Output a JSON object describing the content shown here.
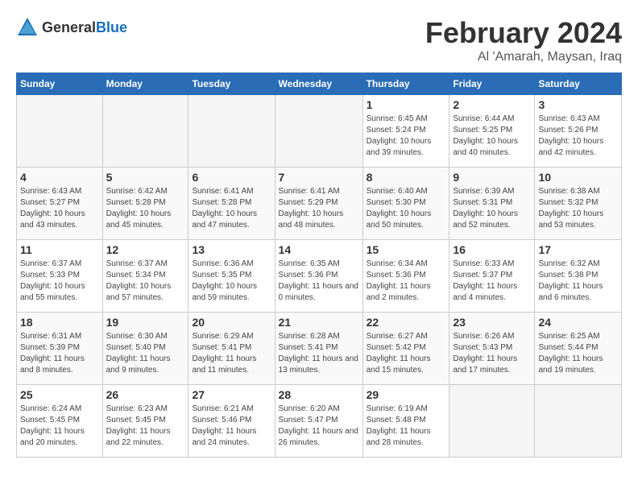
{
  "header": {
    "logo_general": "General",
    "logo_blue": "Blue",
    "month": "February 2024",
    "location": "Al 'Amarah, Maysan, Iraq"
  },
  "weekdays": [
    "Sunday",
    "Monday",
    "Tuesday",
    "Wednesday",
    "Thursday",
    "Friday",
    "Saturday"
  ],
  "weeks": [
    [
      {
        "day": "",
        "empty": true
      },
      {
        "day": "",
        "empty": true
      },
      {
        "day": "",
        "empty": true
      },
      {
        "day": "",
        "empty": true
      },
      {
        "day": "1",
        "sunrise": "6:45 AM",
        "sunset": "5:24 PM",
        "daylight": "10 hours and 39 minutes."
      },
      {
        "day": "2",
        "sunrise": "6:44 AM",
        "sunset": "5:25 PM",
        "daylight": "10 hours and 40 minutes."
      },
      {
        "day": "3",
        "sunrise": "6:43 AM",
        "sunset": "5:26 PM",
        "daylight": "10 hours and 42 minutes."
      }
    ],
    [
      {
        "day": "4",
        "sunrise": "6:43 AM",
        "sunset": "5:27 PM",
        "daylight": "10 hours and 43 minutes."
      },
      {
        "day": "5",
        "sunrise": "6:42 AM",
        "sunset": "5:28 PM",
        "daylight": "10 hours and 45 minutes."
      },
      {
        "day": "6",
        "sunrise": "6:41 AM",
        "sunset": "5:28 PM",
        "daylight": "10 hours and 47 minutes."
      },
      {
        "day": "7",
        "sunrise": "6:41 AM",
        "sunset": "5:29 PM",
        "daylight": "10 hours and 48 minutes."
      },
      {
        "day": "8",
        "sunrise": "6:40 AM",
        "sunset": "5:30 PM",
        "daylight": "10 hours and 50 minutes."
      },
      {
        "day": "9",
        "sunrise": "6:39 AM",
        "sunset": "5:31 PM",
        "daylight": "10 hours and 52 minutes."
      },
      {
        "day": "10",
        "sunrise": "6:38 AM",
        "sunset": "5:32 PM",
        "daylight": "10 hours and 53 minutes."
      }
    ],
    [
      {
        "day": "11",
        "sunrise": "6:37 AM",
        "sunset": "5:33 PM",
        "daylight": "10 hours and 55 minutes."
      },
      {
        "day": "12",
        "sunrise": "6:37 AM",
        "sunset": "5:34 PM",
        "daylight": "10 hours and 57 minutes."
      },
      {
        "day": "13",
        "sunrise": "6:36 AM",
        "sunset": "5:35 PM",
        "daylight": "10 hours and 59 minutes."
      },
      {
        "day": "14",
        "sunrise": "6:35 AM",
        "sunset": "5:36 PM",
        "daylight": "11 hours and 0 minutes."
      },
      {
        "day": "15",
        "sunrise": "6:34 AM",
        "sunset": "5:36 PM",
        "daylight": "11 hours and 2 minutes."
      },
      {
        "day": "16",
        "sunrise": "6:33 AM",
        "sunset": "5:37 PM",
        "daylight": "11 hours and 4 minutes."
      },
      {
        "day": "17",
        "sunrise": "6:32 AM",
        "sunset": "5:38 PM",
        "daylight": "11 hours and 6 minutes."
      }
    ],
    [
      {
        "day": "18",
        "sunrise": "6:31 AM",
        "sunset": "5:39 PM",
        "daylight": "11 hours and 8 minutes."
      },
      {
        "day": "19",
        "sunrise": "6:30 AM",
        "sunset": "5:40 PM",
        "daylight": "11 hours and 9 minutes."
      },
      {
        "day": "20",
        "sunrise": "6:29 AM",
        "sunset": "5:41 PM",
        "daylight": "11 hours and 11 minutes."
      },
      {
        "day": "21",
        "sunrise": "6:28 AM",
        "sunset": "5:41 PM",
        "daylight": "11 hours and 13 minutes."
      },
      {
        "day": "22",
        "sunrise": "6:27 AM",
        "sunset": "5:42 PM",
        "daylight": "11 hours and 15 minutes."
      },
      {
        "day": "23",
        "sunrise": "6:26 AM",
        "sunset": "5:43 PM",
        "daylight": "11 hours and 17 minutes."
      },
      {
        "day": "24",
        "sunrise": "6:25 AM",
        "sunset": "5:44 PM",
        "daylight": "11 hours and 19 minutes."
      }
    ],
    [
      {
        "day": "25",
        "sunrise": "6:24 AM",
        "sunset": "5:45 PM",
        "daylight": "11 hours and 20 minutes."
      },
      {
        "day": "26",
        "sunrise": "6:23 AM",
        "sunset": "5:45 PM",
        "daylight": "11 hours and 22 minutes."
      },
      {
        "day": "27",
        "sunrise": "6:21 AM",
        "sunset": "5:46 PM",
        "daylight": "11 hours and 24 minutes."
      },
      {
        "day": "28",
        "sunrise": "6:20 AM",
        "sunset": "5:47 PM",
        "daylight": "11 hours and 26 minutes."
      },
      {
        "day": "29",
        "sunrise": "6:19 AM",
        "sunset": "5:48 PM",
        "daylight": "11 hours and 28 minutes."
      },
      {
        "day": "",
        "empty": true
      },
      {
        "day": "",
        "empty": true
      }
    ]
  ]
}
